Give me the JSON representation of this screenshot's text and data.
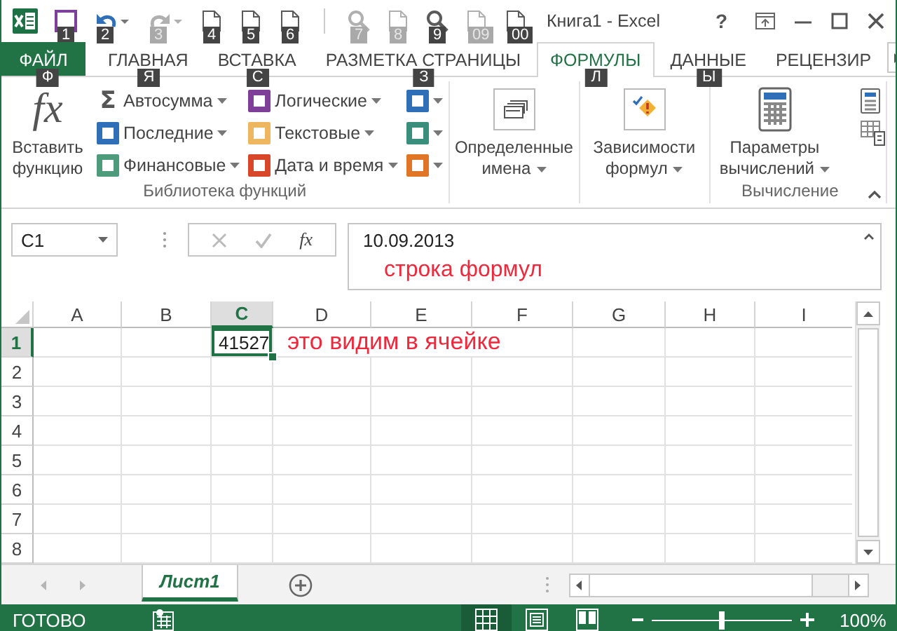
{
  "window": {
    "title": "Книга1 - Excel",
    "help": "?"
  },
  "quick_access": [
    {
      "kind": "save",
      "keytip": "1",
      "disabled": false
    },
    {
      "kind": "undo",
      "keytip": "2",
      "disabled": false
    },
    {
      "kind": "redo",
      "keytip": "3",
      "disabled": true
    },
    {
      "kind": "page",
      "keytip": "4",
      "disabled": false
    },
    {
      "kind": "page",
      "keytip": "5",
      "disabled": false
    },
    {
      "kind": "page",
      "keytip": "6",
      "disabled": false
    },
    {
      "kind": "search",
      "keytip": "7",
      "disabled": true
    },
    {
      "kind": "page",
      "keytip": "8",
      "disabled": true
    },
    {
      "kind": "search",
      "keytip": "9",
      "disabled": false
    },
    {
      "kind": "page",
      "keytip": "09",
      "disabled": true
    },
    {
      "kind": "page",
      "keytip": "00",
      "disabled": false
    }
  ],
  "tabs": [
    {
      "kind": "file",
      "label": "ФАЙЛ",
      "keytip": "Ф",
      "selected": false
    },
    {
      "kind": "tab",
      "label": "ГЛАВНАЯ",
      "keytip": "Я",
      "selected": false
    },
    {
      "kind": "tab",
      "label": "ВСТАВКА",
      "keytip": "С",
      "selected": false
    },
    {
      "kind": "tab",
      "label": "РАЗМЕТКА СТРАНИЦЫ",
      "keytip": "З",
      "selected": false
    },
    {
      "kind": "tab",
      "label": "ФОРМУЛЫ",
      "keytip": "Л",
      "selected": true
    },
    {
      "kind": "tab",
      "label": "ДАННЫЕ",
      "keytip": "Ы",
      "selected": false
    },
    {
      "kind": "tab",
      "label": "РЕЦЕНЗИР",
      "selected": false
    }
  ],
  "ribbon": {
    "groups": [
      {
        "label": "Библиотека функций",
        "items": [
          {
            "kind": "function",
            "label": "Вставить функцию",
            "icon_text": "fx"
          },
          {
            "kind": "autosum",
            "label": "Автосумма",
            "icon_text": "Σ"
          },
          {
            "kind": "category",
            "label": "Последние",
            "color": "#2f6fb7"
          },
          {
            "kind": "category",
            "label": "Финансовые",
            "color": "#4d9b7b"
          },
          {
            "kind": "category",
            "label": "Логические",
            "color": "#7d3f98"
          },
          {
            "kind": "category",
            "label": "Текстовые",
            "color": "#efb660"
          },
          {
            "kind": "category",
            "label": "Дата и время",
            "color": "#d9472b"
          },
          {
            "kind": "more",
            "color": "#2f6fb7"
          },
          {
            "kind": "more",
            "color": "#3a8e7c"
          },
          {
            "kind": "more",
            "color": "#e07526"
          }
        ]
      },
      {
        "items": [
          {
            "kind": "names",
            "label": "Определенные имена"
          }
        ]
      },
      {
        "items": [
          {
            "kind": "audit",
            "label": "Зависимости формул"
          }
        ]
      },
      {
        "label": "Вычисление",
        "items": [
          {
            "kind": "options",
            "label": "Параметры вычислений"
          },
          {
            "kind": "calc"
          },
          {
            "kind": "sheetcalc"
          }
        ]
      }
    ]
  },
  "formula_bar": {
    "name_box": "C1",
    "fx": "fx",
    "value": "10.09.2013",
    "annotation": "строка формул"
  },
  "grid": {
    "columns": [
      {
        "label": "A",
        "selected": false
      },
      {
        "label": "B",
        "selected": false
      },
      {
        "label": "C",
        "selected": true
      },
      {
        "label": "D",
        "selected": false
      },
      {
        "label": "E",
        "selected": false
      },
      {
        "label": "F",
        "selected": false
      },
      {
        "label": "G",
        "selected": false
      },
      {
        "label": "H",
        "selected": false
      },
      {
        "label": "I",
        "selected": false
      }
    ],
    "rows": [
      {
        "label": "1",
        "selected": true,
        "cells": [
          {
            "kind": "empty"
          },
          {
            "kind": "empty"
          },
          {
            "kind": "value",
            "value": "41527",
            "selected": true
          },
          {
            "kind": "note",
            "text": "это видим в ячейке"
          }
        ]
      },
      {
        "label": "2",
        "selected": false
      },
      {
        "label": "3",
        "selected": false
      },
      {
        "label": "4",
        "selected": false
      },
      {
        "label": "5",
        "selected": false
      },
      {
        "label": "6",
        "selected": false
      },
      {
        "label": "7",
        "selected": false
      },
      {
        "label": "8",
        "selected": false
      }
    ]
  },
  "sheets": [
    {
      "label": "Лист1",
      "selected": true
    }
  ],
  "status_bar": {
    "text": "ГОТОВО",
    "views": [
      {
        "kind": "normal",
        "selected": true
      },
      {
        "kind": "layout",
        "selected": false
      },
      {
        "kind": "break",
        "selected": false
      }
    ],
    "zoom": {
      "level": 0.5,
      "reading": "100%"
    }
  }
}
